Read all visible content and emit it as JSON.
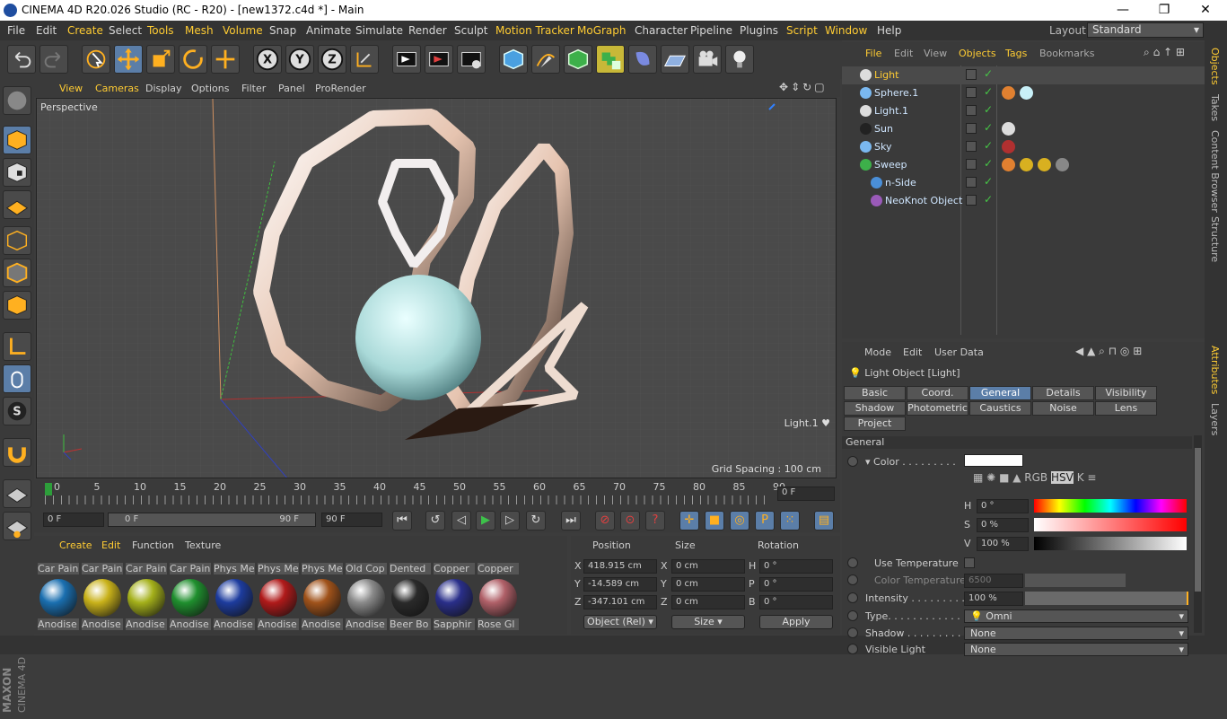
{
  "titlebar": {
    "title": "CINEMA 4D R20.026 Studio (RC - R20) - [new1372.c4d *] - Main"
  },
  "menubar": {
    "items": [
      {
        "label": "File",
        "hl": false
      },
      {
        "label": "Edit",
        "hl": false
      },
      {
        "label": "Create",
        "hl": true
      },
      {
        "label": "Select",
        "hl": false
      },
      {
        "label": "Tools",
        "hl": true
      },
      {
        "label": "Mesh",
        "hl": true
      },
      {
        "label": "Volume",
        "hl": true
      },
      {
        "label": "Snap",
        "hl": false
      },
      {
        "label": "Animate",
        "hl": false
      },
      {
        "label": "Simulate",
        "hl": false
      },
      {
        "label": "Render",
        "hl": false
      },
      {
        "label": "Sculpt",
        "hl": false
      },
      {
        "label": "Motion Tracker",
        "hl": true
      },
      {
        "label": "MoGraph",
        "hl": true
      },
      {
        "label": "Character",
        "hl": false
      },
      {
        "label": "Pipeline",
        "hl": false
      },
      {
        "label": "Plugins",
        "hl": false
      },
      {
        "label": "Script",
        "hl": true
      },
      {
        "label": "Window",
        "hl": true
      },
      {
        "label": "Help",
        "hl": false
      }
    ],
    "layout_label": "Layout:",
    "layout_value": "Standard"
  },
  "viewport": {
    "menu": [
      "View",
      "Cameras",
      "Display",
      "Options",
      "Filter",
      "Panel",
      "ProRender"
    ],
    "label": "Perspective",
    "light_label": "Light.1",
    "grid_spacing": "Grid Spacing : 100 cm"
  },
  "timeline": {
    "ticks": [
      "0",
      "5",
      "10",
      "15",
      "20",
      "25",
      "30",
      "35",
      "40",
      "45",
      "50",
      "55",
      "60",
      "65",
      "70",
      "75",
      "80",
      "85",
      "90"
    ],
    "current_frame": "0 F"
  },
  "transport": {
    "start": "0 F",
    "range_start": "0 F",
    "range_end": "90 F",
    "end": "90 F"
  },
  "materials": {
    "menu": [
      "Create",
      "Edit",
      "Function",
      "Texture"
    ],
    "top_row": [
      "Car Pain",
      "Car Pain",
      "Car Pain",
      "Car Pain",
      "Phys Me",
      "Phys Me",
      "Phys Me",
      "Old Cop",
      "Dented",
      "Copper",
      "Copper"
    ],
    "bottom_row": [
      {
        "label": "Anodise",
        "color": "#1a6fb0"
      },
      {
        "label": "Anodise",
        "color": "#c9b21a"
      },
      {
        "label": "Anodise",
        "color": "#a4b01a"
      },
      {
        "label": "Anodise",
        "color": "#1f8f2e"
      },
      {
        "label": "Anodise",
        "color": "#1d3c9e"
      },
      {
        "label": "Anodise",
        "color": "#b01a1a"
      },
      {
        "label": "Anodise",
        "color": "#a0521a"
      },
      {
        "label": "Anodise",
        "color": "#8a8a8a"
      },
      {
        "label": "Beer Bo",
        "color": "#2a2a2a"
      },
      {
        "label": "Sapphir",
        "color": "#2a2f8a"
      },
      {
        "label": "Rose Gl",
        "color": "#b06068"
      }
    ]
  },
  "coords": {
    "headers": [
      "Position",
      "Size",
      "Rotation"
    ],
    "rows": [
      {
        "axis": "X",
        "pos": "418.915 cm",
        "saxis": "X",
        "size": "0 cm",
        "raxis": "H",
        "rot": "0 °"
      },
      {
        "axis": "Y",
        "pos": "-14.589 cm",
        "saxis": "Y",
        "size": "0 cm",
        "raxis": "P",
        "rot": "0 °"
      },
      {
        "axis": "Z",
        "pos": "-347.101 cm",
        "saxis": "Z",
        "size": "0 cm",
        "raxis": "B",
        "rot": "0 °"
      }
    ],
    "mode": "Object (Rel)",
    "size_mode": "Size",
    "apply": "Apply"
  },
  "objects": {
    "menu": [
      {
        "label": "File",
        "hl": true
      },
      {
        "label": "Edit",
        "hl": false
      },
      {
        "label": "View",
        "hl": false
      },
      {
        "label": "Objects",
        "hl": true
      },
      {
        "label": "Tags",
        "hl": true
      },
      {
        "label": "Bookmarks",
        "hl": false
      }
    ],
    "rows": [
      {
        "name": "Light",
        "color": "#ffcc33",
        "icon": "light-icon"
      },
      {
        "name": "Sphere.1",
        "color": "#cfe6ff",
        "icon": "sphere-icon"
      },
      {
        "name": "Light.1",
        "color": "#cfe6ff",
        "icon": "light-icon"
      },
      {
        "name": "Sun",
        "color": "#cfe6ff",
        "icon": "sun-icon"
      },
      {
        "name": "Sky",
        "color": "#cfe6ff",
        "icon": "sky-icon"
      },
      {
        "name": "Sweep",
        "color": "#cfe6ff",
        "icon": "sweep-icon"
      },
      {
        "name": "n-Side",
        "color": "#cfe6ff",
        "icon": "nside-icon"
      },
      {
        "name": "NeoKnot Object",
        "color": "#cfe6ff",
        "icon": "knot-icon"
      }
    ]
  },
  "sidetabs": {
    "top": [
      {
        "label": "Objects",
        "hl": true
      },
      {
        "label": "Takes",
        "hl": false
      },
      {
        "label": "Content Browser",
        "hl": false
      },
      {
        "label": "Structure",
        "hl": false
      }
    ],
    "bottom": [
      {
        "label": "Attributes",
        "hl": true
      },
      {
        "label": "Layers",
        "hl": false
      }
    ]
  },
  "attributes": {
    "menu": [
      "Mode",
      "Edit",
      "User Data"
    ],
    "object_title": "Light Object [Light]",
    "tabs_row1": [
      {
        "label": "Basic",
        "active": false
      },
      {
        "label": "Coord.",
        "active": false
      },
      {
        "label": "General",
        "active": true
      },
      {
        "label": "Details",
        "active": false
      },
      {
        "label": "Visibility",
        "active": false
      }
    ],
    "tabs_row2": [
      "Shadow",
      "Photometric",
      "Caustics",
      "Noise",
      "Lens"
    ],
    "tabs_row3": [
      "Project"
    ],
    "section": "General",
    "color_label": "Color . . . . . . . . .",
    "color_value": "#ffffff",
    "h_label": "H",
    "h_value": "0 °",
    "s_label": "S",
    "s_value": "0 %",
    "v_label": "V",
    "v_value": "100 %",
    "use_temp": "Use Temperature",
    "color_temp": "Color Temperature",
    "color_temp_value": "6500",
    "intensity_label": "Intensity . . . . . . . . .",
    "intensity_value": "100 %",
    "type_label": "Type. . . . . . . . . . . . .",
    "type_value": "Omni",
    "shadow_label": "Shadow . . . . . . . . . .",
    "shadow_value": "None",
    "visible_label": "Visible Light",
    "visible_value": "None"
  }
}
